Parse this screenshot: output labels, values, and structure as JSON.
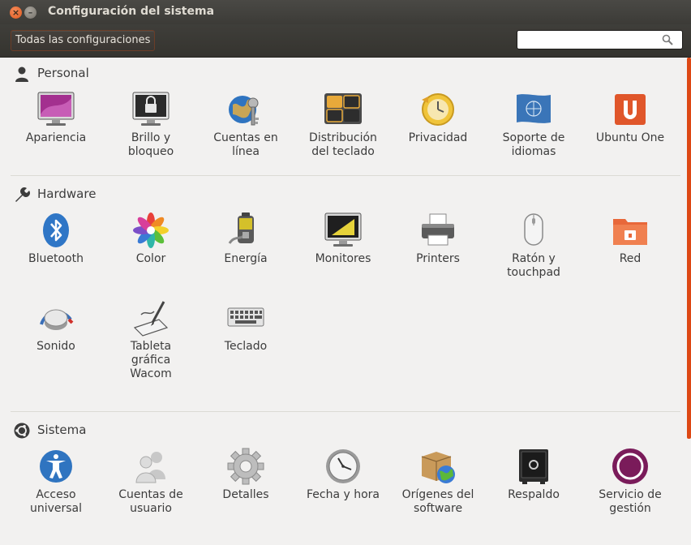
{
  "window": {
    "title": "Configuración del sistema",
    "close_glyph": "×",
    "min_glyph": "–"
  },
  "toolbar": {
    "all_settings_label": "Todas las configuraciones",
    "search_value": "",
    "search_icon": "search-icon"
  },
  "colors": {
    "titlebar": "#3c3b37",
    "content_bg": "#f2f1f0",
    "accent": "#dd4814",
    "text": "#3c3c3c"
  },
  "sections": {
    "personal": {
      "title": "Personal",
      "icon": "person-icon",
      "items": [
        {
          "label": "Apariencia",
          "icon": "appearance-icon"
        },
        {
          "label": "Brillo y\nbloqueo",
          "icon": "brightness-lock-icon"
        },
        {
          "label": "Cuentas en\nlínea",
          "icon": "online-accounts-icon"
        },
        {
          "label": "Distribución\ndel teclado",
          "icon": "keyboard-layout-icon"
        },
        {
          "label": "Privacidad",
          "icon": "privacy-icon"
        },
        {
          "label": "Soporte de\nidiomas",
          "icon": "language-support-icon"
        },
        {
          "label": "Ubuntu One",
          "icon": "ubuntu-one-icon"
        }
      ]
    },
    "hardware": {
      "title": "Hardware",
      "icon": "wrench-icon",
      "items": [
        {
          "label": "Bluetooth",
          "icon": "bluetooth-icon"
        },
        {
          "label": "Color",
          "icon": "color-icon"
        },
        {
          "label": "Energía",
          "icon": "power-icon"
        },
        {
          "label": "Monitores",
          "icon": "displays-icon"
        },
        {
          "label": "Printers",
          "icon": "printer-icon"
        },
        {
          "label": "Ratón y\ntouchpad",
          "icon": "mouse-icon"
        },
        {
          "label": "Red",
          "icon": "network-icon"
        },
        {
          "label": "Sonido",
          "icon": "sound-icon"
        },
        {
          "label": "Tableta\ngráfica\nWacom",
          "icon": "wacom-tablet-icon"
        },
        {
          "label": "Teclado",
          "icon": "keyboard-icon"
        }
      ]
    },
    "sistema": {
      "title": "Sistema",
      "icon": "system-icon",
      "items": [
        {
          "label": "Acceso\nuniversal",
          "icon": "universal-access-icon"
        },
        {
          "label": "Cuentas de\nusuario",
          "icon": "user-accounts-icon"
        },
        {
          "label": "Detalles",
          "icon": "details-gear-icon"
        },
        {
          "label": "Fecha y hora",
          "icon": "clock-icon"
        },
        {
          "label": "Orígenes del\nsoftware",
          "icon": "software-sources-icon"
        },
        {
          "label": "Respaldo",
          "icon": "backup-safe-icon"
        },
        {
          "label": "Servicio de\ngestión",
          "icon": "management-service-icon"
        }
      ]
    }
  }
}
